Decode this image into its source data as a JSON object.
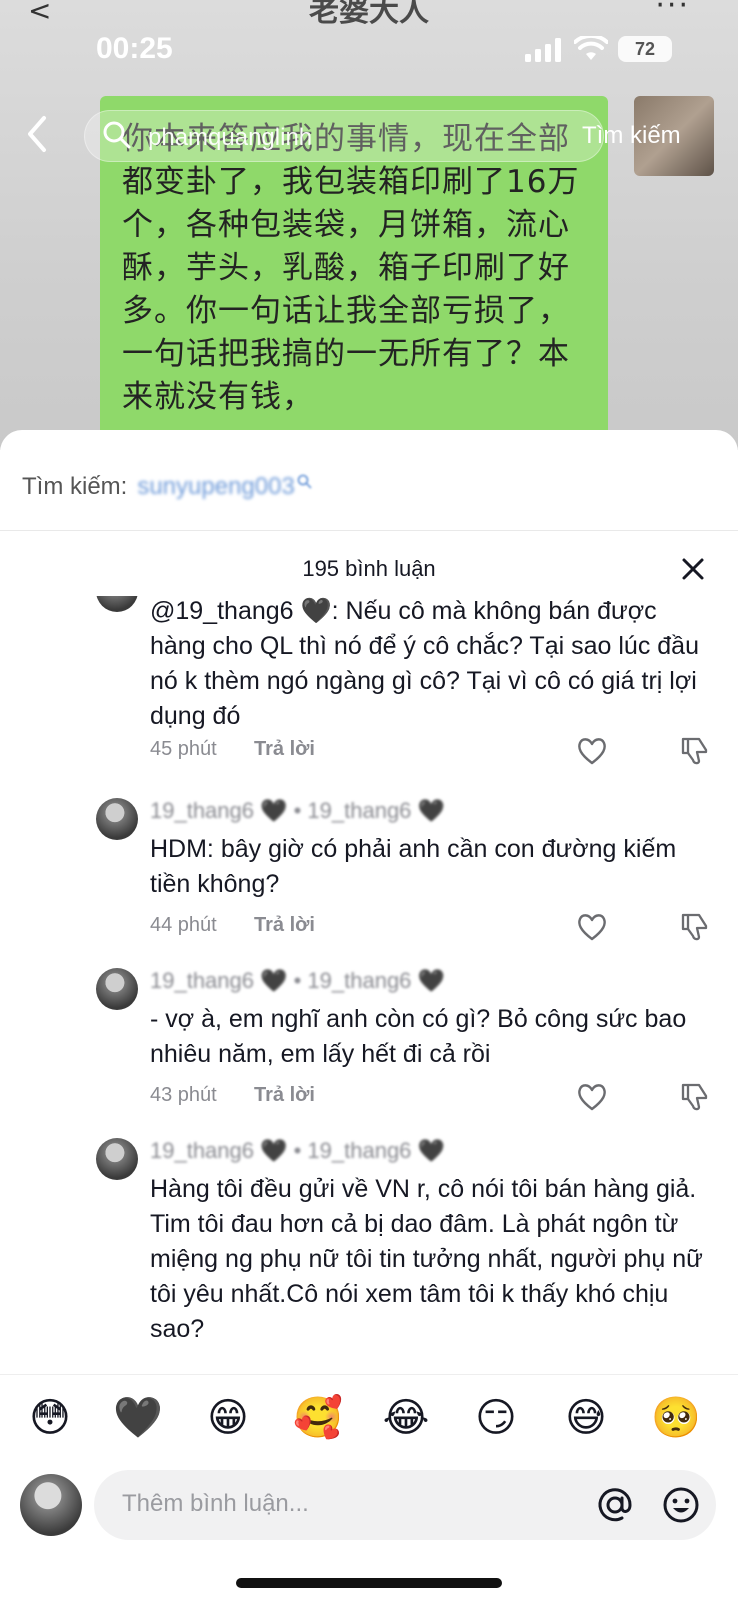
{
  "video": {
    "top_title": "老婆大人",
    "top_left": "<",
    "top_right": "···",
    "chat_text": "你本来答应我的事情，现在全部都变卦了，我包装箱印刷了16万个，各种包装袋，月饼箱，流心酥，芋头，乳酸，箱子印刷了好多。你一句话让我全部亏损了，一句话把我搞的一无所有了？本来就没有钱，"
  },
  "status_bar": {
    "time": "00:25",
    "battery": "72"
  },
  "top_search": {
    "back_icon": "chevron-left-icon",
    "search_icon": "search-icon",
    "username": "phamquanglinh",
    "button": "Tìm kiếm"
  },
  "sheet": {
    "search_label": "Tìm kiếm:",
    "search_term": "sunyupeng003",
    "comments_count": "195 bình luận",
    "close_icon": "close-icon"
  },
  "comments": [
    {
      "user": "",
      "text": "@19_thang6 🖤: Nếu cô mà không bán được hàng cho QL thì nó để ý cô chắc? Tại sao lúc đầu nó k thèm ngó ngàng gì cô? Tại vì cô có giá trị lợi dụng đó",
      "time": "45 phút",
      "reply": "Trả lời"
    },
    {
      "user": "19_thang6 🖤 • 19_thang6 🖤",
      "text": "HDM: bây giờ có phải anh cần con đường kiếm tiền không?",
      "time": "44 phút",
      "reply": "Trả lời"
    },
    {
      "user": "19_thang6 🖤 • 19_thang6 🖤",
      "text": "- vợ à, em nghĩ anh còn có gì? Bỏ công sức bao nhiêu năm, em lấy hết đi cả rồi",
      "time": "43 phút",
      "reply": "Trả lời"
    },
    {
      "user": "19_thang6 🖤 • 19_thang6 🖤",
      "text": "Hàng tôi đều gửi về VN r, cô nói tôi bán hàng giả. Tim tôi đau hơn cả bị dao đâm. Là phát ngôn từ miệng ng phụ nữ tôi tin tưởng nhất, người phụ nữ tôi yêu nhất.Cô nói xem tâm tôi k thấy khó chịu sao?",
      "time": "",
      "reply": ""
    }
  ],
  "emoji_bar": [
    "😳",
    "🖤",
    "😁",
    "🥰",
    "😂",
    "😏",
    "😅",
    "🥺"
  ],
  "composer": {
    "placeholder": "Thêm bình luận...",
    "at_icon": "at-icon",
    "emoji_icon": "smiley-icon"
  },
  "colors": {
    "chat_bubble": "#8fd96a",
    "link_blue": "#6f9bd9",
    "muted_text": "#8a8b91",
    "text": "#161823"
  }
}
